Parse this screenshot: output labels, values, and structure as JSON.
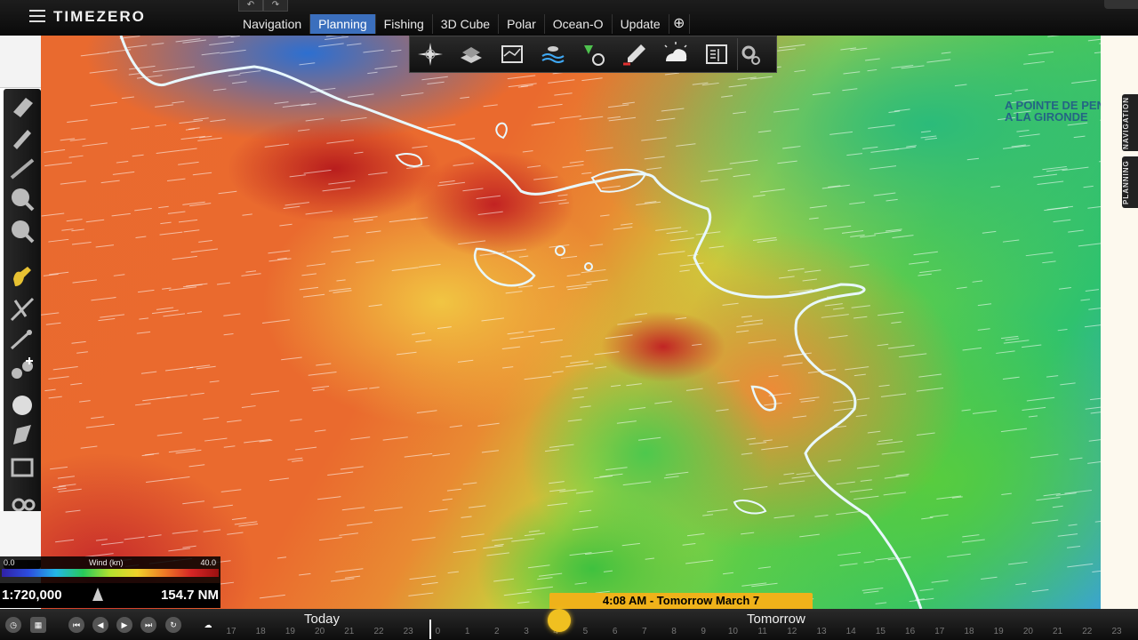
{
  "app": {
    "name": "TIMEZERO"
  },
  "tabs": [
    {
      "label": "Navigation",
      "active": false
    },
    {
      "label": "Planning",
      "active": true
    },
    {
      "label": "Fishing",
      "active": false
    },
    {
      "label": "3D Cube",
      "active": false
    },
    {
      "label": "Polar",
      "active": false
    },
    {
      "label": "Ocean-O",
      "active": false
    },
    {
      "label": "Update",
      "active": false
    },
    {
      "label": "⊕",
      "active": false
    }
  ],
  "toolbar": {
    "undo": "↶",
    "redo": "↷"
  },
  "side_tabs": {
    "navigation": "NAVIGATION",
    "planning": "PLANNING"
  },
  "chart_overlay": {
    "line1": "A POINTE DE PEN",
    "line2": "A LA GIRONDE"
  },
  "legend": {
    "min": "0.0",
    "label": "Wind (kn)",
    "max": "40.0"
  },
  "scale": {
    "ratio": "1:720,000",
    "distance": "154.7 NM"
  },
  "timeline": {
    "tooltip": "4:08 AM - Tomorrow March 7",
    "today_label": "Today",
    "tomorrow_label": "Tomorrow",
    "hours": [
      "17",
      "18",
      "19",
      "20",
      "21",
      "22",
      "23",
      "0",
      "1",
      "2",
      "3",
      "4",
      "5",
      "6",
      "7",
      "8",
      "9",
      "10",
      "11",
      "12",
      "13",
      "14",
      "15",
      "16",
      "17",
      "18",
      "19",
      "20",
      "21",
      "22",
      "23"
    ]
  },
  "colors": {
    "active_tab": "#3b6fbd",
    "timeline_marker": "#f0c020"
  }
}
